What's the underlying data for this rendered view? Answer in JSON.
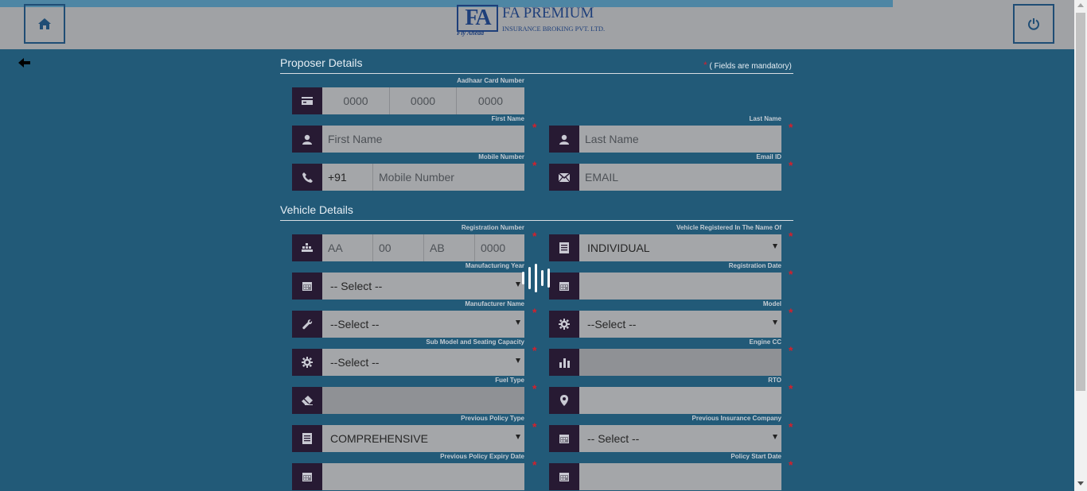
{
  "header": {
    "logo_letters": "FA",
    "logo_tagline": "Fly Ahead",
    "logo_name": "FA PREMIUM",
    "logo_subtitle": "INSURANCE BROKING PVT. LTD."
  },
  "proposer": {
    "title": "Proposer Details",
    "mandatory_star": "*",
    "mandatory_note": "( Fields are mandatory)",
    "aadhaar_label": "Aadhaar Card Number",
    "aadhaar_placeholders": [
      "0000",
      "0000",
      "0000"
    ],
    "first_name_label": "First Name",
    "first_name_placeholder": "First Name",
    "last_name_label": "Last Name",
    "last_name_placeholder": "Last Name",
    "mobile_label": "Mobile Number",
    "mobile_prefix": "+91",
    "mobile_placeholder": "Mobile Number",
    "email_label": "Email ID",
    "email_placeholder": "EMAIL"
  },
  "vehicle": {
    "title": "Vehicle Details",
    "reg_number_label": "Registration Number",
    "reg_number_placeholders": [
      "AA",
      "00",
      "AB",
      "0000"
    ],
    "registered_in_name_label": "Vehicle Registered In The Name Of",
    "registered_in_name_value": "INDIVIDUAL",
    "manufacturing_year_label": "Manufacturing Year",
    "manufacturing_year_value": "-- Select --",
    "registration_date_label": "Registration Date",
    "registration_date_value": "",
    "manufacturer_label": "Manufacturer Name",
    "manufacturer_value": "--Select --",
    "model_label": "Model",
    "model_value": "--Select --",
    "submodel_label": "Sub Model and Seating Capacity",
    "submodel_value": "--Select --",
    "engine_cc_label": "Engine CC",
    "engine_cc_value": "",
    "fuel_type_label": "Fuel Type",
    "fuel_type_value": "",
    "rto_label": "RTO",
    "rto_value": "",
    "prev_policy_type_label": "Previous Policy Type",
    "prev_policy_type_value": "COMPREHENSIVE",
    "prev_insurer_label": "Previous Insurance Company",
    "prev_insurer_value": "-- Select --",
    "prev_expiry_label": "Previous Policy Expiry Date",
    "prev_expiry_value": "",
    "policy_start_label": "Policy Start Date",
    "policy_start_value": ""
  },
  "required_star": "*",
  "icons": {
    "home": "home-icon",
    "power": "power-icon",
    "back": "back-arrow-icon",
    "card": "card-icon",
    "user": "user-icon",
    "phone": "phone-icon",
    "mail": "mail-icon",
    "registration": "registration-icon",
    "list": "list-icon",
    "calendar": "calendar-icon",
    "wrench": "wrench-icon",
    "gear": "gear-icon",
    "bar-chart": "bar-chart-icon",
    "eraser": "eraser-icon",
    "location": "location-icon",
    "loader": "loading-spinner-icon"
  },
  "colors": {
    "page_bg": "#225a78",
    "header_bg": "#a0a2a5",
    "icon_bg": "#271a33",
    "input_bg": "#a4a6a9",
    "required": "#d4202c",
    "brand": "#1e3f7a"
  }
}
